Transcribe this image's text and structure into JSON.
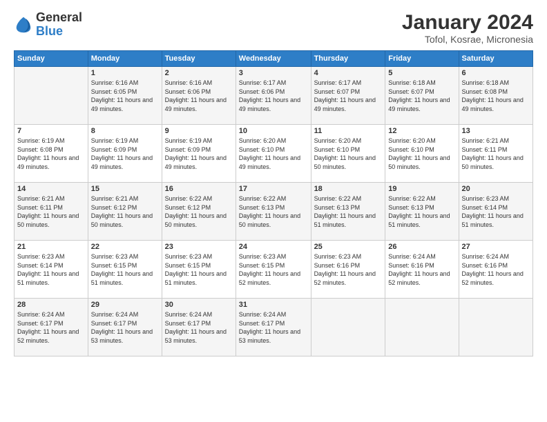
{
  "logo": {
    "general": "General",
    "blue": "Blue"
  },
  "header": {
    "title": "January 2024",
    "subtitle": "Tofol, Kosrae, Micronesia"
  },
  "weekdays": [
    "Sunday",
    "Monday",
    "Tuesday",
    "Wednesday",
    "Thursday",
    "Friday",
    "Saturday"
  ],
  "weeks": [
    [
      {
        "day": "",
        "sunrise": "",
        "sunset": "",
        "daylight": ""
      },
      {
        "day": "1",
        "sunrise": "Sunrise: 6:16 AM",
        "sunset": "Sunset: 6:05 PM",
        "daylight": "Daylight: 11 hours and 49 minutes."
      },
      {
        "day": "2",
        "sunrise": "Sunrise: 6:16 AM",
        "sunset": "Sunset: 6:06 PM",
        "daylight": "Daylight: 11 hours and 49 minutes."
      },
      {
        "day": "3",
        "sunrise": "Sunrise: 6:17 AM",
        "sunset": "Sunset: 6:06 PM",
        "daylight": "Daylight: 11 hours and 49 minutes."
      },
      {
        "day": "4",
        "sunrise": "Sunrise: 6:17 AM",
        "sunset": "Sunset: 6:07 PM",
        "daylight": "Daylight: 11 hours and 49 minutes."
      },
      {
        "day": "5",
        "sunrise": "Sunrise: 6:18 AM",
        "sunset": "Sunset: 6:07 PM",
        "daylight": "Daylight: 11 hours and 49 minutes."
      },
      {
        "day": "6",
        "sunrise": "Sunrise: 6:18 AM",
        "sunset": "Sunset: 6:08 PM",
        "daylight": "Daylight: 11 hours and 49 minutes."
      }
    ],
    [
      {
        "day": "7",
        "sunrise": "Sunrise: 6:19 AM",
        "sunset": "Sunset: 6:08 PM",
        "daylight": "Daylight: 11 hours and 49 minutes."
      },
      {
        "day": "8",
        "sunrise": "Sunrise: 6:19 AM",
        "sunset": "Sunset: 6:09 PM",
        "daylight": "Daylight: 11 hours and 49 minutes."
      },
      {
        "day": "9",
        "sunrise": "Sunrise: 6:19 AM",
        "sunset": "Sunset: 6:09 PM",
        "daylight": "Daylight: 11 hours and 49 minutes."
      },
      {
        "day": "10",
        "sunrise": "Sunrise: 6:20 AM",
        "sunset": "Sunset: 6:10 PM",
        "daylight": "Daylight: 11 hours and 49 minutes."
      },
      {
        "day": "11",
        "sunrise": "Sunrise: 6:20 AM",
        "sunset": "Sunset: 6:10 PM",
        "daylight": "Daylight: 11 hours and 50 minutes."
      },
      {
        "day": "12",
        "sunrise": "Sunrise: 6:20 AM",
        "sunset": "Sunset: 6:10 PM",
        "daylight": "Daylight: 11 hours and 50 minutes."
      },
      {
        "day": "13",
        "sunrise": "Sunrise: 6:21 AM",
        "sunset": "Sunset: 6:11 PM",
        "daylight": "Daylight: 11 hours and 50 minutes."
      }
    ],
    [
      {
        "day": "14",
        "sunrise": "Sunrise: 6:21 AM",
        "sunset": "Sunset: 6:11 PM",
        "daylight": "Daylight: 11 hours and 50 minutes."
      },
      {
        "day": "15",
        "sunrise": "Sunrise: 6:21 AM",
        "sunset": "Sunset: 6:12 PM",
        "daylight": "Daylight: 11 hours and 50 minutes."
      },
      {
        "day": "16",
        "sunrise": "Sunrise: 6:22 AM",
        "sunset": "Sunset: 6:12 PM",
        "daylight": "Daylight: 11 hours and 50 minutes."
      },
      {
        "day": "17",
        "sunrise": "Sunrise: 6:22 AM",
        "sunset": "Sunset: 6:13 PM",
        "daylight": "Daylight: 11 hours and 50 minutes."
      },
      {
        "day": "18",
        "sunrise": "Sunrise: 6:22 AM",
        "sunset": "Sunset: 6:13 PM",
        "daylight": "Daylight: 11 hours and 51 minutes."
      },
      {
        "day": "19",
        "sunrise": "Sunrise: 6:22 AM",
        "sunset": "Sunset: 6:13 PM",
        "daylight": "Daylight: 11 hours and 51 minutes."
      },
      {
        "day": "20",
        "sunrise": "Sunrise: 6:23 AM",
        "sunset": "Sunset: 6:14 PM",
        "daylight": "Daylight: 11 hours and 51 minutes."
      }
    ],
    [
      {
        "day": "21",
        "sunrise": "Sunrise: 6:23 AM",
        "sunset": "Sunset: 6:14 PM",
        "daylight": "Daylight: 11 hours and 51 minutes."
      },
      {
        "day": "22",
        "sunrise": "Sunrise: 6:23 AM",
        "sunset": "Sunset: 6:15 PM",
        "daylight": "Daylight: 11 hours and 51 minutes."
      },
      {
        "day": "23",
        "sunrise": "Sunrise: 6:23 AM",
        "sunset": "Sunset: 6:15 PM",
        "daylight": "Daylight: 11 hours and 51 minutes."
      },
      {
        "day": "24",
        "sunrise": "Sunrise: 6:23 AM",
        "sunset": "Sunset: 6:15 PM",
        "daylight": "Daylight: 11 hours and 52 minutes."
      },
      {
        "day": "25",
        "sunrise": "Sunrise: 6:23 AM",
        "sunset": "Sunset: 6:16 PM",
        "daylight": "Daylight: 11 hours and 52 minutes."
      },
      {
        "day": "26",
        "sunrise": "Sunrise: 6:24 AM",
        "sunset": "Sunset: 6:16 PM",
        "daylight": "Daylight: 11 hours and 52 minutes."
      },
      {
        "day": "27",
        "sunrise": "Sunrise: 6:24 AM",
        "sunset": "Sunset: 6:16 PM",
        "daylight": "Daylight: 11 hours and 52 minutes."
      }
    ],
    [
      {
        "day": "28",
        "sunrise": "Sunrise: 6:24 AM",
        "sunset": "Sunset: 6:17 PM",
        "daylight": "Daylight: 11 hours and 52 minutes."
      },
      {
        "day": "29",
        "sunrise": "Sunrise: 6:24 AM",
        "sunset": "Sunset: 6:17 PM",
        "daylight": "Daylight: 11 hours and 53 minutes."
      },
      {
        "day": "30",
        "sunrise": "Sunrise: 6:24 AM",
        "sunset": "Sunset: 6:17 PM",
        "daylight": "Daylight: 11 hours and 53 minutes."
      },
      {
        "day": "31",
        "sunrise": "Sunrise: 6:24 AM",
        "sunset": "Sunset: 6:17 PM",
        "daylight": "Daylight: 11 hours and 53 minutes."
      },
      {
        "day": "",
        "sunrise": "",
        "sunset": "",
        "daylight": ""
      },
      {
        "day": "",
        "sunrise": "",
        "sunset": "",
        "daylight": ""
      },
      {
        "day": "",
        "sunrise": "",
        "sunset": "",
        "daylight": ""
      }
    ]
  ]
}
